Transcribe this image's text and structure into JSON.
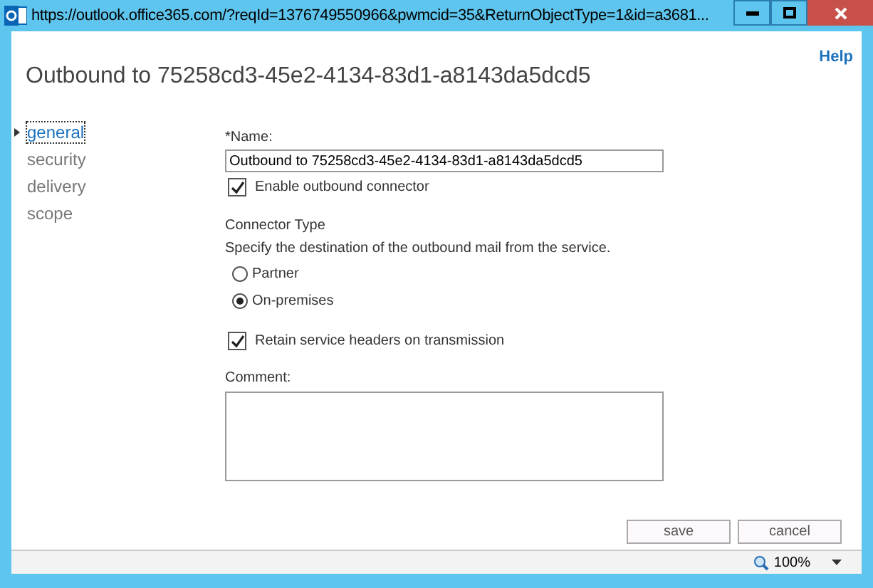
{
  "window": {
    "title": "https://outlook.office365.com/?reqId=1376749550966&pwmcid=35&ReturnObjectType=1&id=a3681..."
  },
  "help": "Help",
  "heading": "Outbound to 75258cd3-45e2-4134-83d1-a8143da5dcd5",
  "nav": [
    {
      "label": "general",
      "selected": true
    },
    {
      "label": "security",
      "selected": false
    },
    {
      "label": "delivery",
      "selected": false
    },
    {
      "label": "scope",
      "selected": false
    }
  ],
  "name_field": {
    "label": "*Name:",
    "value": "Outbound to 75258cd3-45e2-4134-83d1-a8143da5dcd5"
  },
  "enable": {
    "label": "Enable outbound connector",
    "checked": true
  },
  "connector_type": {
    "title": "Connector Type",
    "description": "Specify the destination of the outbound mail from the service.",
    "options": [
      {
        "label": "Partner",
        "selected": false
      },
      {
        "label": "On-premises",
        "selected": true
      }
    ]
  },
  "retain": {
    "label": "Retain service headers on transmission",
    "checked": true
  },
  "comment": {
    "label": "Comment:"
  },
  "buttons": [
    "save",
    "cancel"
  ],
  "status_bar": {
    "zoom": "100%"
  }
}
